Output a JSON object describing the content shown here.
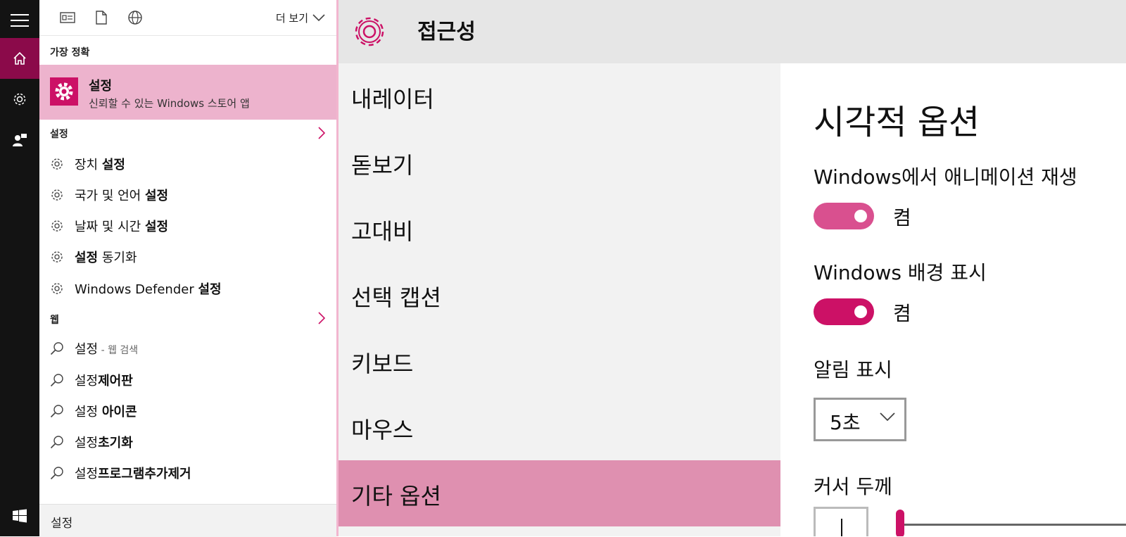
{
  "taskbar": {
    "items": [
      {
        "icon": "hamburger-menu-icon"
      },
      {
        "icon": "home-icon",
        "active": true
      },
      {
        "icon": "gear-icon"
      },
      {
        "icon": "feedback-icon"
      },
      {
        "icon": "windows-start-icon"
      }
    ]
  },
  "search_panel": {
    "filter_more_label": "더 보기",
    "best_match_header": "가장 정확",
    "best_match": {
      "title": "설정",
      "subtitle": "신뢰할 수 있는 Windows 스토어 앱"
    },
    "settings_header": "설정",
    "settings_results": [
      {
        "plain": "장치 ",
        "bold": "설정"
      },
      {
        "plain": "국가 및 언어 ",
        "bold": "설정"
      },
      {
        "plain": "날짜 및 시간 ",
        "bold": "설정"
      },
      {
        "bold": "설정",
        "plain": " 동기화"
      },
      {
        "plain": "Windows Defender ",
        "bold": "설정"
      }
    ],
    "web_header": "웹",
    "web_results": [
      {
        "plain": "설정",
        "small": " - 웹 검색"
      },
      {
        "plain": "설정",
        "bold": "제어판"
      },
      {
        "plain": "설정 ",
        "bold": "아이콘"
      },
      {
        "plain": "설정",
        "bold": "초기화"
      },
      {
        "plain": "설정",
        "bold": "프로그램추가제거"
      }
    ],
    "search_box_value": "설정"
  },
  "settings_app": {
    "title": "접근성",
    "nav": [
      {
        "label": "내레이터"
      },
      {
        "label": "돋보기"
      },
      {
        "label": "고대비"
      },
      {
        "label": "선택 캡션"
      },
      {
        "label": "키보드"
      },
      {
        "label": "마우스"
      },
      {
        "label": "기타 옵션",
        "selected": true
      }
    ],
    "content": {
      "heading": "시각적 옵션",
      "animation_label": "Windows에서 애니메이션 재생",
      "animation_state": "켬",
      "background_label": "Windows 배경 표시",
      "background_state": "켬",
      "notification_label": "알림 표시",
      "notification_value": "5초",
      "cursor_label": "커서 두께"
    }
  },
  "colors": {
    "accent": "#cc1166",
    "accent_light": "#df90b0",
    "best_match_bg": "#edb3cd",
    "toggle_on_1": "#d9508f",
    "toggle_on_2": "#cc1166",
    "rail_bg": "#131313",
    "rail_active": "#8b0a4a"
  }
}
